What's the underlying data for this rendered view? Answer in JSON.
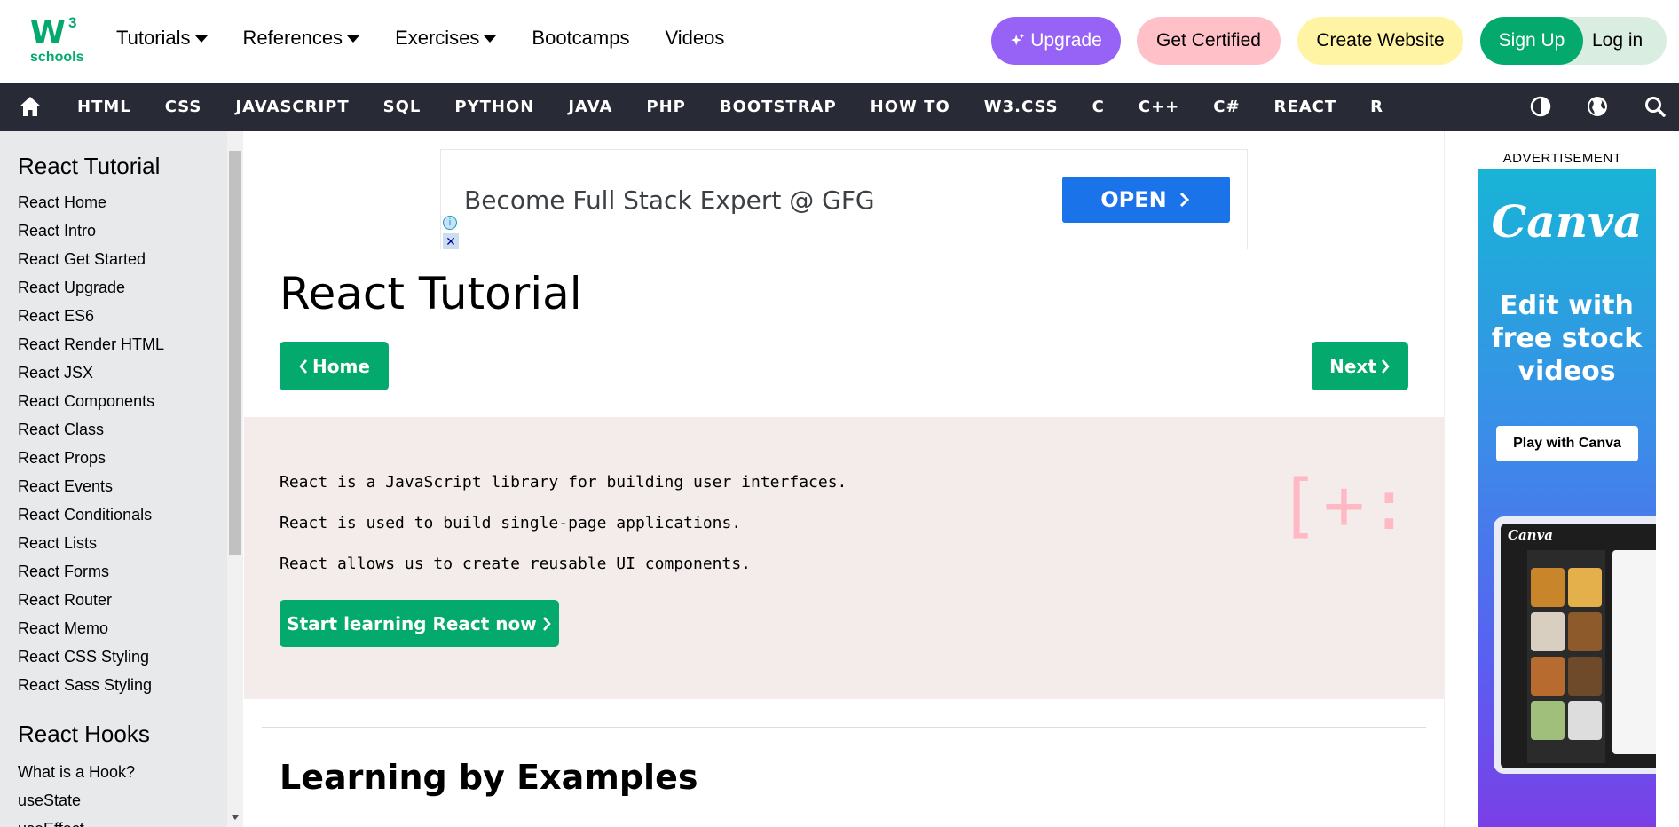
{
  "logo": {
    "mark": "W",
    "superscript": "3",
    "subtitle": "schools"
  },
  "topnav": {
    "menus": [
      "Tutorials",
      "References",
      "Exercises"
    ],
    "links": [
      "Bootcamps",
      "Videos"
    ]
  },
  "buttons": {
    "upgrade": "Upgrade",
    "get_certified": "Get Certified",
    "create_website": "Create Website",
    "sign_up": "Sign Up",
    "log_in": "Log in"
  },
  "darknav": {
    "items": [
      "HTML",
      "CSS",
      "JAVASCRIPT",
      "SQL",
      "PYTHON",
      "JAVA",
      "PHP",
      "BOOTSTRAP",
      "HOW TO",
      "W3.CSS",
      "C",
      "C++",
      "C#",
      "REACT",
      "R"
    ],
    "icons": [
      "home-icon",
      "contrast-icon",
      "globe-icon",
      "search-icon"
    ]
  },
  "sidebar": {
    "section1_title": "React Tutorial",
    "section1_links": [
      "React Home",
      "React Intro",
      "React Get Started",
      "React Upgrade",
      "React ES6",
      "React Render HTML",
      "React JSX",
      "React Components",
      "React Class",
      "React Props",
      "React Events",
      "React Conditionals",
      "React Lists",
      "React Forms",
      "React Router",
      "React Memo",
      "React CSS Styling",
      "React Sass Styling"
    ],
    "section2_title": "React Hooks",
    "section2_links": [
      "What is a Hook?",
      "useState",
      "useEffect"
    ]
  },
  "top_ad": {
    "text": "Become Full Stack Expert @ GFG",
    "cta": "OPEN"
  },
  "main": {
    "title": "React Tutorial",
    "home_button": "Home",
    "next_button": "Next",
    "intro_lines": [
      "React is a JavaScript library for building user interfaces.",
      "React is used to build single-page applications.",
      "React allows us to create reusable UI components."
    ],
    "start_button": "Start learning React now",
    "decoration": "[+:",
    "section_title": "Learning by Examples"
  },
  "right_ad": {
    "label": "ADVERTISEMENT",
    "brand": "Canva",
    "headline": "Edit with free stock videos",
    "cta": "Play with Canva",
    "screen_brand": "Canva"
  },
  "colors": {
    "brand_green": "#04aa6d",
    "dark_nav": "#282a35",
    "upgrade_purple": "#9763f6",
    "certified_pink": "#ffc0c7",
    "create_yellow": "#fff4a3",
    "intro_bg": "#f3eceb",
    "ad_blue": "#1a73e8"
  }
}
